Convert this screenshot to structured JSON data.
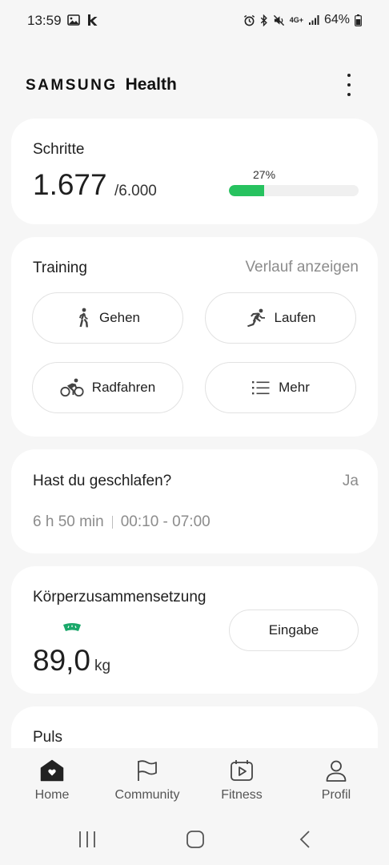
{
  "status_bar": {
    "time": "13:59",
    "left_icons": [
      "image-icon",
      "k-app-icon"
    ],
    "right_icons": [
      "alarm-icon",
      "bluetooth-icon",
      "mute-icon",
      "4g-icon",
      "signal-icon"
    ],
    "network": "4G+",
    "battery": "64%"
  },
  "header": {
    "brand_samsung": "SAMSUNG",
    "brand_health": "Health"
  },
  "steps": {
    "title": "Schritte",
    "value": "1.677",
    "goal": "/6.000",
    "percent_label": "27%",
    "progress": 0.27,
    "accent": "#27c25f"
  },
  "training": {
    "title": "Training",
    "history_link": "Verlauf anzeigen",
    "buttons": [
      {
        "label": "Gehen",
        "icon": "walking-icon"
      },
      {
        "label": "Laufen",
        "icon": "running-icon"
      },
      {
        "label": "Radfahren",
        "icon": "cycling-icon"
      },
      {
        "label": "Mehr",
        "icon": "list-icon"
      }
    ]
  },
  "sleep": {
    "title": "Hast du geschlafen?",
    "action": "Ja",
    "duration": "6 h 50 min",
    "range": "00:10 - 07:00"
  },
  "body": {
    "title": "Körperzusammensetzung",
    "value": "89,0",
    "unit": "kg",
    "input_label": "Eingabe",
    "gauge_color": "#1aa86a"
  },
  "pulse": {
    "title": "Puls"
  },
  "bottom_nav": {
    "items": [
      {
        "label": "Home",
        "icon": "home-icon",
        "active": true
      },
      {
        "label": "Community",
        "icon": "flag-icon",
        "active": false
      },
      {
        "label": "Fitness",
        "icon": "fitness-video-icon",
        "active": false
      },
      {
        "label": "Profil",
        "icon": "profile-icon",
        "active": false
      }
    ]
  },
  "system_nav": [
    "recents-button",
    "home-button",
    "back-button"
  ]
}
